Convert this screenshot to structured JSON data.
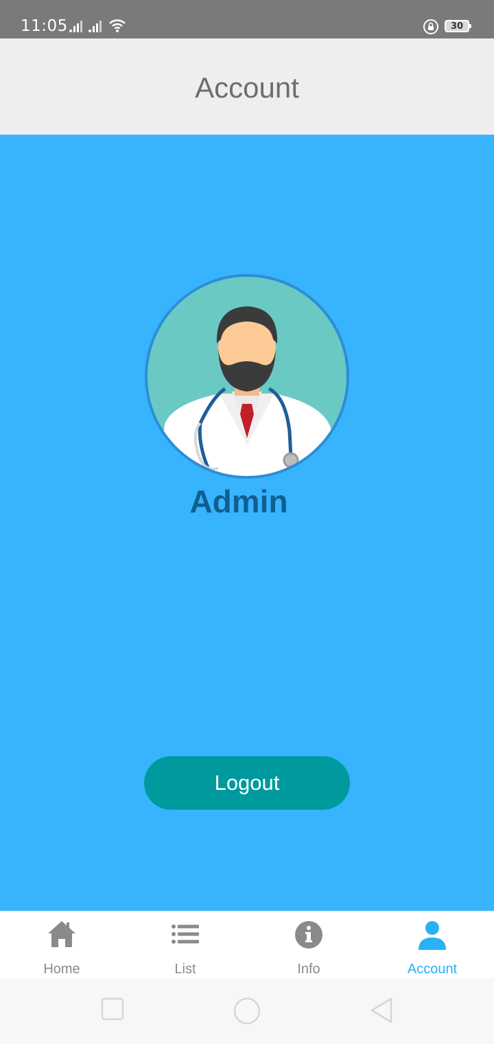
{
  "status_bar": {
    "time": "11:05",
    "battery": "30",
    "icons": [
      "signal-icon",
      "signal-icon",
      "wifi-icon",
      "rotation-lock-icon",
      "battery-icon"
    ]
  },
  "header": {
    "title": "Account"
  },
  "profile": {
    "name": "Admin",
    "avatar_icon": "doctor-avatar"
  },
  "actions": {
    "logout_label": "Logout"
  },
  "bottom_nav": {
    "items": [
      {
        "label": "Home",
        "icon": "home-icon",
        "active": false
      },
      {
        "label": "List",
        "icon": "list-icon",
        "active": false
      },
      {
        "label": "Info",
        "icon": "info-icon",
        "active": false
      },
      {
        "label": "Account",
        "icon": "person-icon",
        "active": true
      }
    ]
  },
  "system_nav": {
    "icons": [
      "recents-icon",
      "home-circle-icon",
      "back-icon"
    ]
  },
  "colors": {
    "primary_bg": "#38b4ff",
    "header_bg": "#eeeeee",
    "button": "#009a9e",
    "active_tab": "#2ab0f5",
    "username": "#0f5f93"
  }
}
